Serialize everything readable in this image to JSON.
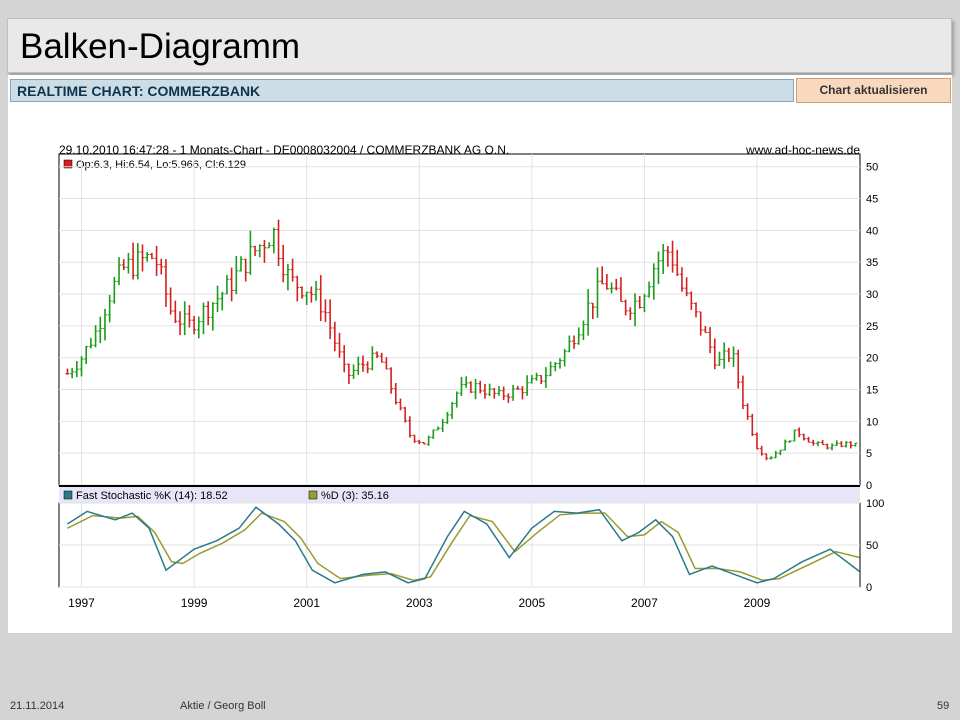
{
  "slide": {
    "title": "Balken-Diagramm",
    "footer_date": "21.11.2014",
    "footer_center": "Aktie  / Georg Boll",
    "page_number": "59"
  },
  "widget": {
    "header": "REALTIME CHART: COMMERZBANK",
    "button_label": "Chart aktualisieren"
  },
  "chart_data": {
    "type": "bar",
    "subtype": "ohlc",
    "header_left": "29.10.2010 16:47:28 - 1 Monats-Chart - DE0008032004 / COMMERZBANK AG O.N.",
    "header_right": "www.ad-hoc-news.de",
    "legend_price": "Op:6.3, Hi:6.54, Lo:5.966, Cl:6.129",
    "legend_k": "Fast Stochastic %K (14): 18.52",
    "legend_d": "%D (3): 35.16",
    "x_ticks": [
      "1997",
      "1999",
      "2001",
      "2003",
      "2005",
      "2007",
      "2009"
    ],
    "xlim": [
      1996.6,
      2010.83
    ],
    "price_ylim": [
      0,
      52
    ],
    "price_yticks": [
      0,
      5,
      10,
      15,
      20,
      25,
      30,
      35,
      40,
      45,
      50
    ],
    "stoch_ylim": [
      0,
      100
    ],
    "stoch_yticks": [
      0,
      50,
      100
    ],
    "grid": true,
    "colors": {
      "up": "#1a9c1a",
      "down": "#d42020",
      "k_line": "#2a7a8a",
      "d_line": "#9a9a30",
      "legend_bg": "#e6e6f8"
    },
    "price_series": [
      {
        "x": 1996.75,
        "close": 17.5
      },
      {
        "x": 1997.0,
        "close": 20.0
      },
      {
        "x": 1997.25,
        "close": 24.0
      },
      {
        "x": 1997.5,
        "close": 30.0
      },
      {
        "x": 1997.75,
        "close": 34.0
      },
      {
        "x": 1998.0,
        "close": 35.0
      },
      {
        "x": 1998.3,
        "close": 36.0
      },
      {
        "x": 1998.6,
        "close": 27.0
      },
      {
        "x": 1998.9,
        "close": 25.0
      },
      {
        "x": 1999.25,
        "close": 28.0
      },
      {
        "x": 1999.6,
        "close": 31.0
      },
      {
        "x": 1999.9,
        "close": 35.0
      },
      {
        "x": 2000.2,
        "close": 38.0
      },
      {
        "x": 2000.4,
        "close": 40.0
      },
      {
        "x": 2000.7,
        "close": 32.0
      },
      {
        "x": 2001.0,
        "close": 31.0
      },
      {
        "x": 2001.3,
        "close": 28.0
      },
      {
        "x": 2001.7,
        "close": 17.0
      },
      {
        "x": 2002.0,
        "close": 19.0
      },
      {
        "x": 2002.3,
        "close": 20.0
      },
      {
        "x": 2002.6,
        "close": 13.0
      },
      {
        "x": 2002.85,
        "close": 7.5
      },
      {
        "x": 2003.1,
        "close": 6.5
      },
      {
        "x": 2003.4,
        "close": 10.0
      },
      {
        "x": 2003.7,
        "close": 15.0
      },
      {
        "x": 2004.0,
        "close": 15.5
      },
      {
        "x": 2004.4,
        "close": 14.0
      },
      {
        "x": 2004.8,
        "close": 15.0
      },
      {
        "x": 2005.2,
        "close": 17.0
      },
      {
        "x": 2005.6,
        "close": 21.0
      },
      {
        "x": 2006.0,
        "close": 28.0
      },
      {
        "x": 2006.3,
        "close": 32.0
      },
      {
        "x": 2006.6,
        "close": 28.0
      },
      {
        "x": 2006.9,
        "close": 29.0
      },
      {
        "x": 2007.2,
        "close": 35.0
      },
      {
        "x": 2007.45,
        "close": 37.0
      },
      {
        "x": 2007.7,
        "close": 30.0
      },
      {
        "x": 2008.0,
        "close": 25.0
      },
      {
        "x": 2008.3,
        "close": 19.0
      },
      {
        "x": 2008.55,
        "close": 21.0
      },
      {
        "x": 2008.75,
        "close": 13.0
      },
      {
        "x": 2009.0,
        "close": 6.0
      },
      {
        "x": 2009.2,
        "close": 4.0
      },
      {
        "x": 2009.45,
        "close": 6.0
      },
      {
        "x": 2009.7,
        "close": 8.5
      },
      {
        "x": 2010.0,
        "close": 6.5
      },
      {
        "x": 2010.3,
        "close": 6.0
      },
      {
        "x": 2010.6,
        "close": 6.5
      },
      {
        "x": 2010.82,
        "close": 6.13
      }
    ],
    "stoch_k": [
      {
        "x": 1996.75,
        "y": 75
      },
      {
        "x": 1997.1,
        "y": 90
      },
      {
        "x": 1997.6,
        "y": 80
      },
      {
        "x": 1997.9,
        "y": 88
      },
      {
        "x": 1998.2,
        "y": 70
      },
      {
        "x": 1998.5,
        "y": 20
      },
      {
        "x": 1998.7,
        "y": 30
      },
      {
        "x": 1999.0,
        "y": 45
      },
      {
        "x": 1999.4,
        "y": 55
      },
      {
        "x": 1999.8,
        "y": 70
      },
      {
        "x": 2000.1,
        "y": 95
      },
      {
        "x": 2000.5,
        "y": 75
      },
      {
        "x": 2000.8,
        "y": 55
      },
      {
        "x": 2001.1,
        "y": 20
      },
      {
        "x": 2001.5,
        "y": 5
      },
      {
        "x": 2002.0,
        "y": 15
      },
      {
        "x": 2002.4,
        "y": 18
      },
      {
        "x": 2002.8,
        "y": 5
      },
      {
        "x": 2003.1,
        "y": 10
      },
      {
        "x": 2003.5,
        "y": 60
      },
      {
        "x": 2003.8,
        "y": 90
      },
      {
        "x": 2004.2,
        "y": 75
      },
      {
        "x": 2004.6,
        "y": 35
      },
      {
        "x": 2005.0,
        "y": 70
      },
      {
        "x": 2005.4,
        "y": 90
      },
      {
        "x": 2005.8,
        "y": 88
      },
      {
        "x": 2006.2,
        "y": 92
      },
      {
        "x": 2006.6,
        "y": 55
      },
      {
        "x": 2006.9,
        "y": 65
      },
      {
        "x": 2007.2,
        "y": 80
      },
      {
        "x": 2007.5,
        "y": 60
      },
      {
        "x": 2007.8,
        "y": 15
      },
      {
        "x": 2008.2,
        "y": 25
      },
      {
        "x": 2008.6,
        "y": 15
      },
      {
        "x": 2009.0,
        "y": 5
      },
      {
        "x": 2009.3,
        "y": 10
      },
      {
        "x": 2009.8,
        "y": 30
      },
      {
        "x": 2010.3,
        "y": 45
      },
      {
        "x": 2010.82,
        "y": 18.52
      }
    ],
    "stoch_d": [
      {
        "x": 1996.75,
        "y": 70
      },
      {
        "x": 1997.2,
        "y": 85
      },
      {
        "x": 1997.7,
        "y": 82
      },
      {
        "x": 1998.0,
        "y": 84
      },
      {
        "x": 1998.3,
        "y": 65
      },
      {
        "x": 1998.6,
        "y": 30
      },
      {
        "x": 1998.8,
        "y": 28
      },
      {
        "x": 1999.1,
        "y": 40
      },
      {
        "x": 1999.5,
        "y": 52
      },
      {
        "x": 1999.9,
        "y": 68
      },
      {
        "x": 2000.2,
        "y": 88
      },
      {
        "x": 2000.6,
        "y": 78
      },
      {
        "x": 2000.9,
        "y": 58
      },
      {
        "x": 2001.2,
        "y": 28
      },
      {
        "x": 2001.6,
        "y": 10
      },
      {
        "x": 2002.1,
        "y": 14
      },
      {
        "x": 2002.5,
        "y": 16
      },
      {
        "x": 2002.9,
        "y": 8
      },
      {
        "x": 2003.2,
        "y": 12
      },
      {
        "x": 2003.6,
        "y": 55
      },
      {
        "x": 2003.9,
        "y": 85
      },
      {
        "x": 2004.3,
        "y": 78
      },
      {
        "x": 2004.7,
        "y": 42
      },
      {
        "x": 2005.1,
        "y": 65
      },
      {
        "x": 2005.5,
        "y": 86
      },
      {
        "x": 2005.9,
        "y": 88
      },
      {
        "x": 2006.3,
        "y": 88
      },
      {
        "x": 2006.7,
        "y": 60
      },
      {
        "x": 2007.0,
        "y": 62
      },
      {
        "x": 2007.3,
        "y": 78
      },
      {
        "x": 2007.6,
        "y": 65
      },
      {
        "x": 2007.9,
        "y": 22
      },
      {
        "x": 2008.3,
        "y": 22
      },
      {
        "x": 2008.7,
        "y": 18
      },
      {
        "x": 2009.1,
        "y": 8
      },
      {
        "x": 2009.4,
        "y": 10
      },
      {
        "x": 2009.9,
        "y": 26
      },
      {
        "x": 2010.4,
        "y": 42
      },
      {
        "x": 2010.82,
        "y": 35.16
      }
    ]
  }
}
